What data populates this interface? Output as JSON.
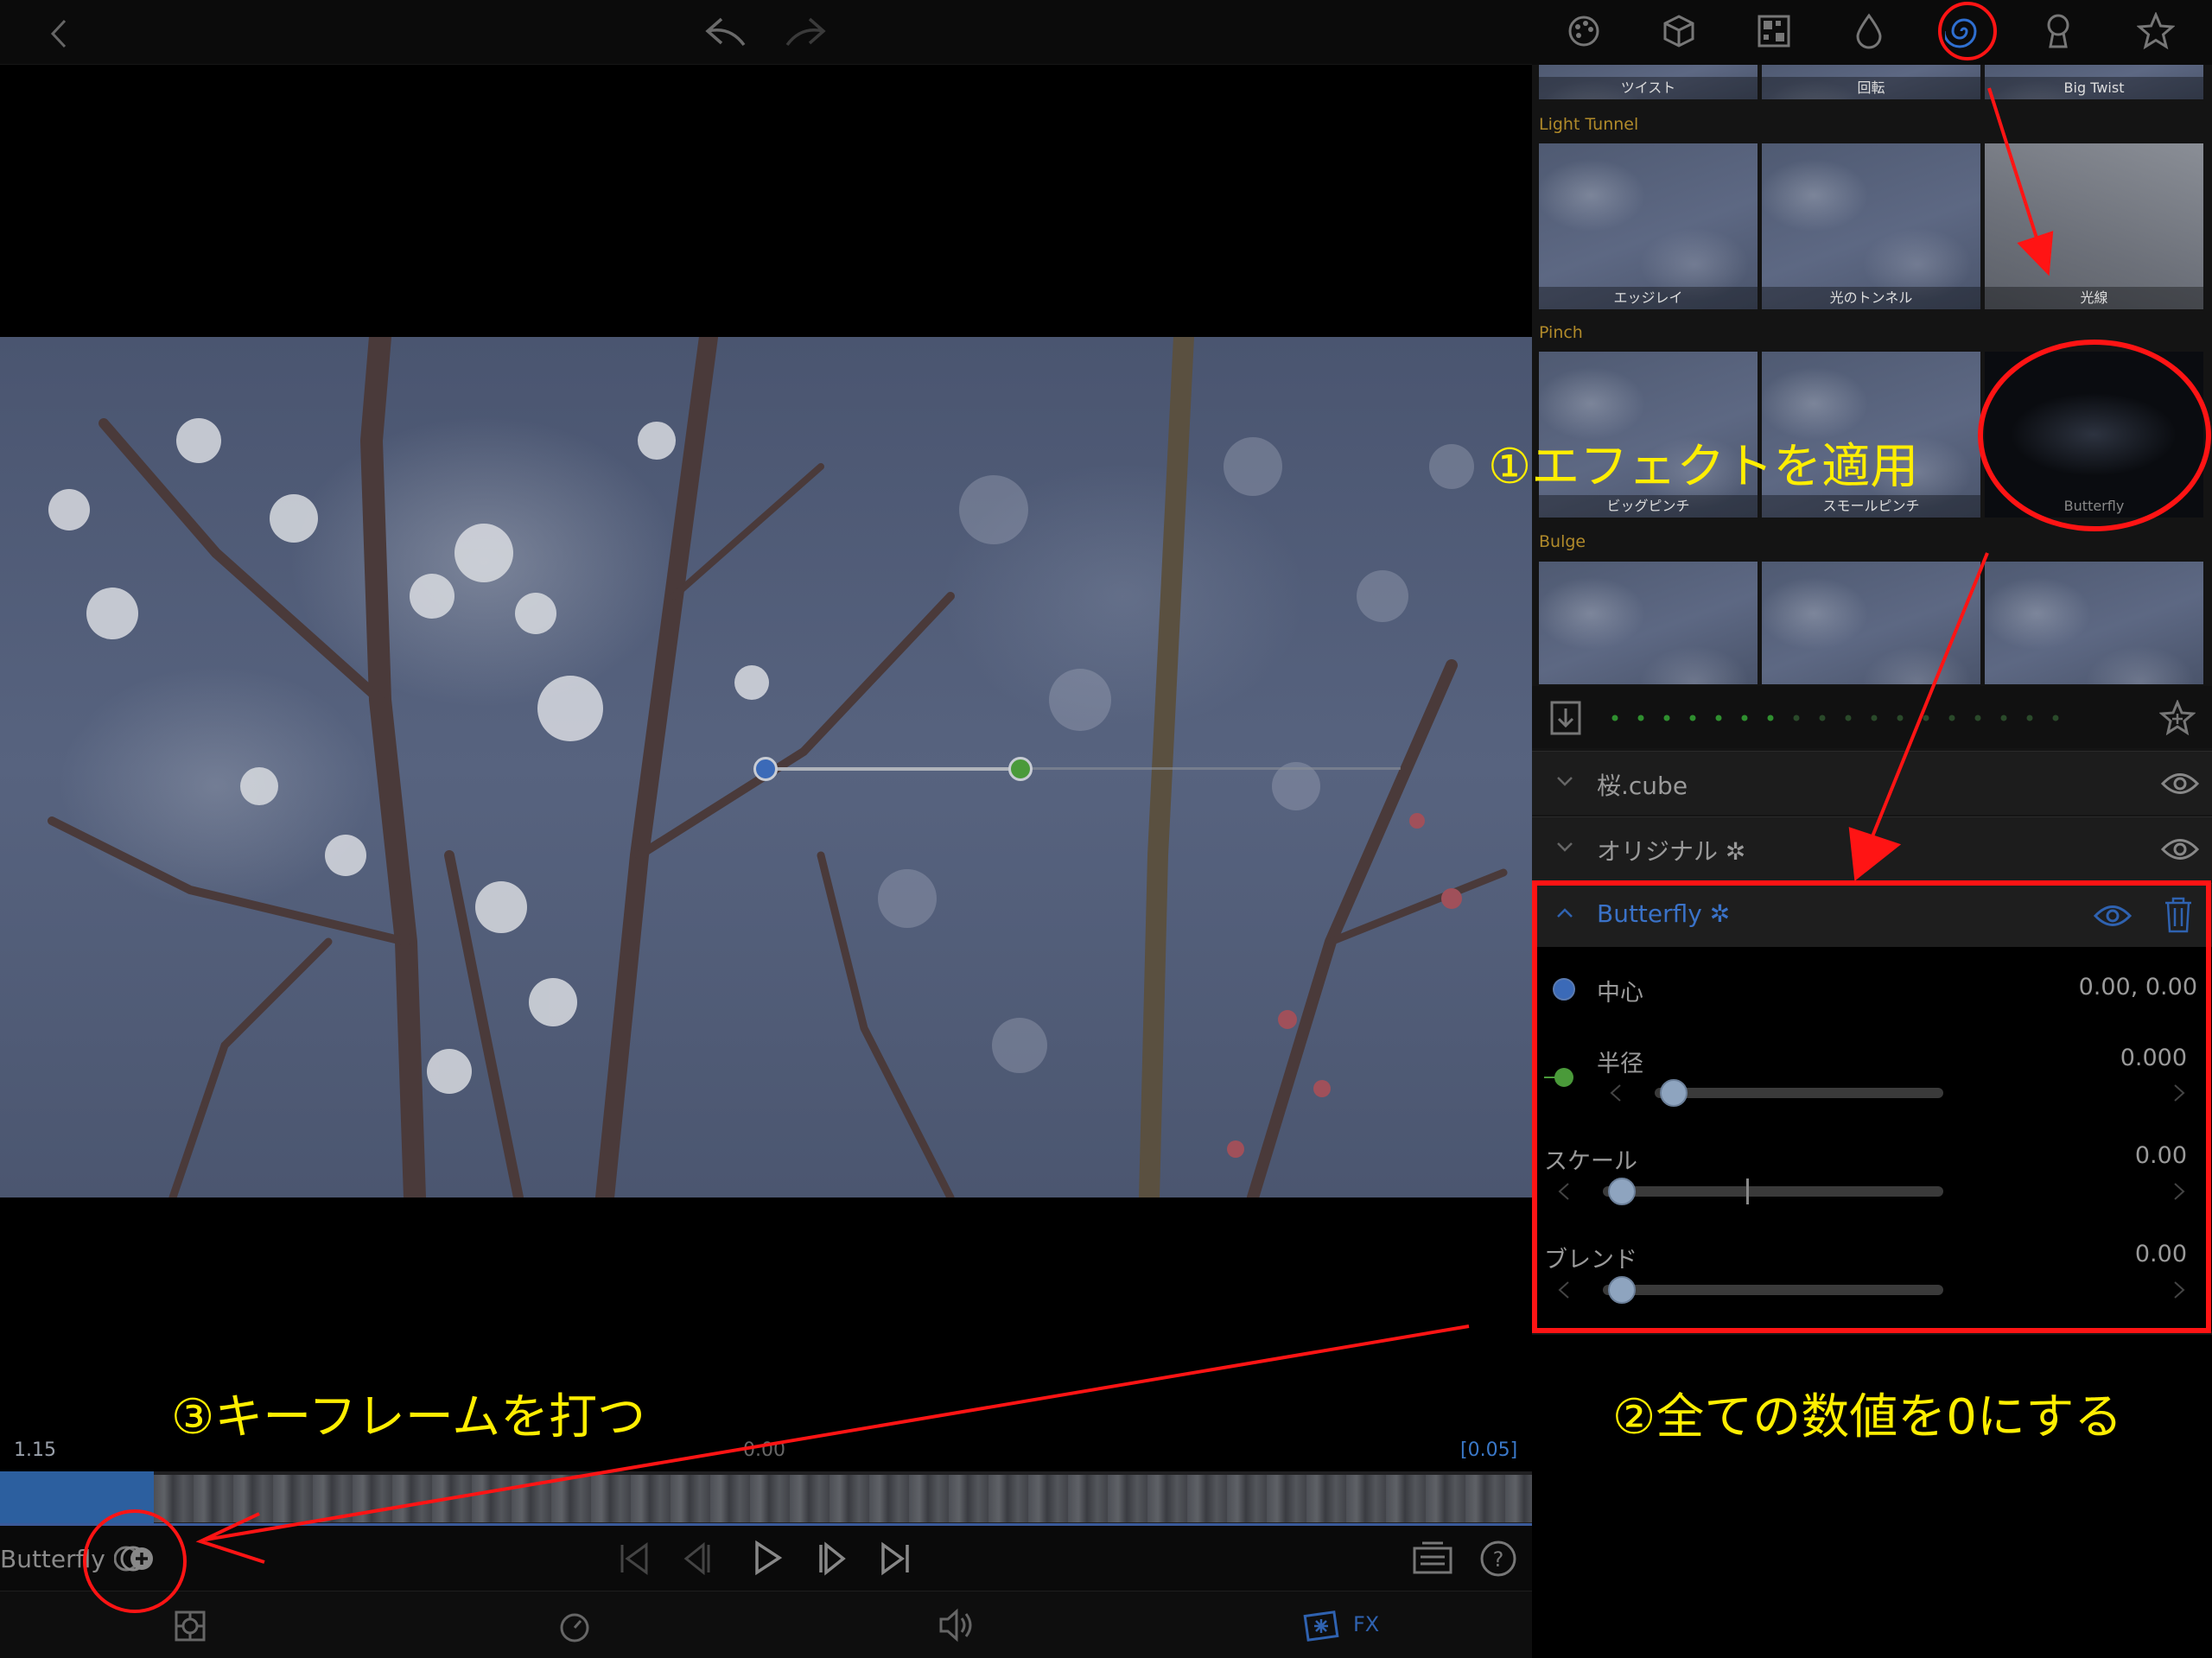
{
  "panel": {
    "top_row_captions": [
      "ツイスト",
      "回転",
      "Big Twist"
    ],
    "categories": [
      {
        "label": "Light Tunnel",
        "items": [
          "エッジレイ",
          "光のトンネル",
          "光線"
        ]
      },
      {
        "label": "Pinch",
        "items": [
          "ビッグピンチ",
          "スモールピンチ",
          "Butterfly"
        ]
      },
      {
        "label": "Bulge",
        "items": [
          "",
          "",
          ""
        ]
      }
    ],
    "layers": [
      {
        "name": "桜.cube"
      },
      {
        "name": "オリジナル ✲"
      },
      {
        "name": "Butterfly ✲"
      }
    ],
    "params": {
      "center": {
        "label": "中心",
        "value": "0.00, 0.00"
      },
      "radius": {
        "label": "半径",
        "value": "0.000"
      },
      "scale": {
        "label": "スケール",
        "value": "0.00"
      },
      "blend": {
        "label": "ブレンド",
        "value": "0.00"
      }
    }
  },
  "timeline": {
    "left_time": "1.15",
    "center_time": "0.00",
    "right_time": "[0.05]",
    "effect_label": "Butterfly"
  },
  "bottom_nav": {
    "fx_label": "FX"
  },
  "annotations": {
    "step1": "①エフェクトを適用",
    "step2": "②全ての数値を0にする",
    "step3": "③キーフレームを打つ"
  },
  "colors": {
    "annotation": "#ffee00",
    "callout": "#ff0000",
    "accent": "#2c5f9f"
  }
}
